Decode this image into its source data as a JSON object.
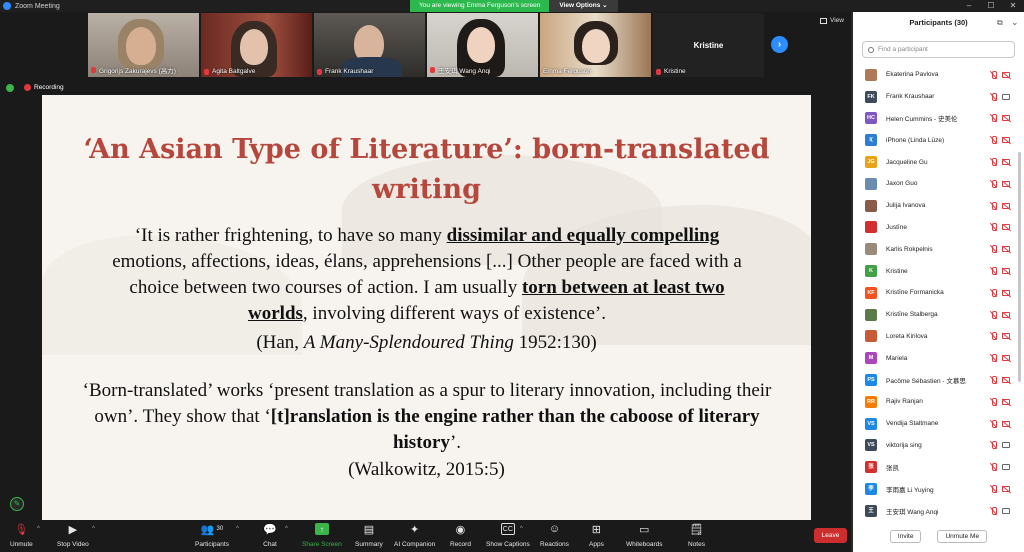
{
  "window": {
    "title": "Zoom Meeting"
  },
  "banner": {
    "message": "You are viewing Emma Ferguson's screen",
    "options": "View Options"
  },
  "view_label": "View",
  "recording_label": "Recording",
  "video_tiles": [
    {
      "name": "Grigorijs Zakurajevs (高力)"
    },
    {
      "name": "Agita Baltgalve"
    },
    {
      "name": "Frank Kraushaar"
    },
    {
      "name": "王安琪 Wang Anqi"
    },
    {
      "name": "Emma Ferguson"
    },
    {
      "name": "Kristine",
      "big_name": "Kristine"
    }
  ],
  "slide": {
    "title": "‘An Asian Type of Literature’: born-translated writing",
    "quote1": {
      "p1": "‘It is rather frightening, to have so many ",
      "b1": "dissimilar and equally compelling",
      "p2": " emotions, affections, ideas, élans, apprehensions [...] Other people are faced with a choice between two courses of action. I am usually ",
      "b2": "torn between at least two worlds",
      "p3": ", involving different ways of existence’."
    },
    "citation1": {
      "pre": "(Han, ",
      "title": "A Many-Splendoured Thing",
      "post": " 1952:130)"
    },
    "quote2": {
      "p1": "‘Born-translated’ works ‘present translation as a spur to literary innovation, including their own’. They show that ‘",
      "b1": "[t]ranslation is the engine rather than the caboose of literary history",
      "p2": "’."
    },
    "citation2": "(Walkowitz, 2015:5)"
  },
  "participants_panel": {
    "title": "Participants (30)",
    "search_placeholder": "Find a participant",
    "items": [
      {
        "initials": "",
        "name": "Ekaterina Pavlova",
        "color": "#b07a5a",
        "cam": "off"
      },
      {
        "initials": "FK",
        "name": "Frank Kraushaar",
        "color": "#3d4a5a",
        "cam": "on"
      },
      {
        "initials": "HC",
        "name": "Helen Cummins - 史美伦",
        "color": "#7e57c2",
        "cam": "off"
      },
      {
        "initials": "I(",
        "name": "iPhone (Linda Lūze)",
        "color": "#2d7fd3",
        "cam": "off"
      },
      {
        "initials": "JG",
        "name": "Jacqueline Gu",
        "color": "#e8a317",
        "cam": "off"
      },
      {
        "initials": "",
        "name": "Jaxon Guo",
        "color": "#6a8caf",
        "cam": "off"
      },
      {
        "initials": "",
        "name": "Julija Ivanova",
        "color": "#8a5a4a",
        "cam": "off"
      },
      {
        "initials": "",
        "name": "Justīne",
        "color": "#d32f2f",
        "cam": "off"
      },
      {
        "initials": "",
        "name": "Karlis Rokpelnis",
        "color": "#9a8a7a",
        "cam": "off"
      },
      {
        "initials": "K",
        "name": "Kristine",
        "color": "#43a047",
        "cam": "off"
      },
      {
        "initials": "KF",
        "name": "Kristīne Formanicka",
        "color": "#f4511e",
        "cam": "off"
      },
      {
        "initials": "",
        "name": "Kristīne Stalberga",
        "color": "#5a7a4a",
        "cam": "off"
      },
      {
        "initials": "",
        "name": "Loreta Kirilova",
        "color": "#c65a3a",
        "cam": "off"
      },
      {
        "initials": "M",
        "name": "Mariela",
        "color": "#ab47bc",
        "cam": "off"
      },
      {
        "initials": "PS",
        "name": "Pacôme Sébastien - 文慕思",
        "color": "#1e88e5",
        "cam": "off"
      },
      {
        "initials": "RR",
        "name": "Rajiv Ranjan",
        "color": "#f57c00",
        "cam": "off"
      },
      {
        "initials": "VS",
        "name": "Vendija Staltmane",
        "color": "#1e88e5",
        "cam": "off"
      },
      {
        "initials": "VS",
        "name": "viktorija sing",
        "color": "#3d4a5a",
        "cam": "on"
      },
      {
        "initials": "张",
        "name": "张凯",
        "color": "#d32f2f",
        "cam": "on"
      },
      {
        "initials": "李",
        "name": "李雨嘉 Li Yuying",
        "color": "#1e88e5",
        "cam": "off"
      },
      {
        "initials": "王",
        "name": "王安琪 Wang Anqi",
        "color": "#3d4a5a",
        "cam": "on"
      }
    ],
    "invite_label": "Invite",
    "unmute_me_label": "Unmute Me"
  },
  "toolbar": {
    "unmute": "Unmute",
    "stop_video": "Stop Video",
    "participants": "Participants",
    "participants_count": "30",
    "chat": "Chat",
    "share_screen": "Share Screen",
    "summary": "Summary",
    "ai_companion": "AI Companion",
    "record": "Record",
    "show_captions": "Show Captions",
    "reactions": "Reactions",
    "apps": "Apps",
    "whiteboards": "Whiteboards",
    "notes": "Notes",
    "leave": "Leave"
  }
}
